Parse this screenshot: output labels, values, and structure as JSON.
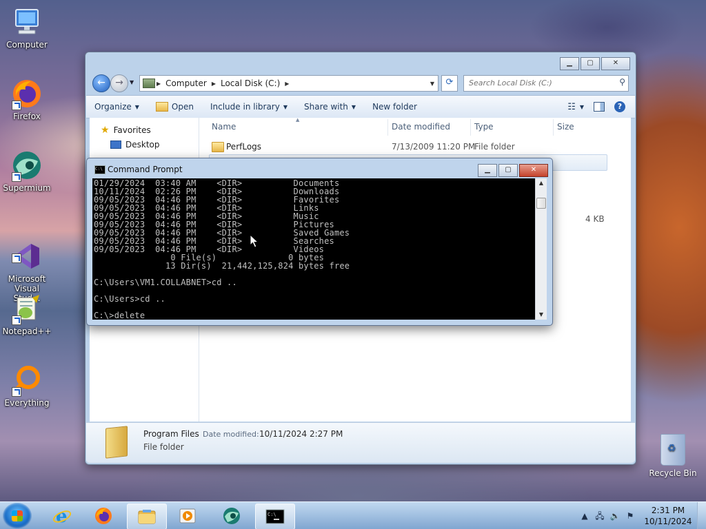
{
  "desktop": {
    "icons": [
      {
        "label": "Computer"
      },
      {
        "label": "Firefox"
      },
      {
        "label": "Supermium"
      },
      {
        "label": "Microsoft\nVisual Stud..."
      },
      {
        "label": "Notepad++"
      },
      {
        "label": "Everything"
      }
    ],
    "recycle_bin": "Recycle Bin"
  },
  "explorer": {
    "address": {
      "segments": [
        "Computer",
        "Local Disk (C:)"
      ]
    },
    "search_placeholder": "Search Local Disk (C:)",
    "toolbar": {
      "organize": "Organize",
      "open": "Open",
      "include_in_library": "Include in library",
      "share_with": "Share with",
      "new_folder": "New folder"
    },
    "nav": {
      "favorites": "Favorites",
      "desktop": "Desktop"
    },
    "columns": {
      "name": "Name",
      "date_modified": "Date modified",
      "type": "Type",
      "size": "Size"
    },
    "rows": [
      {
        "name": "PerfLogs",
        "date": "7/13/2009 11:20 PM",
        "type": "File folder",
        "size": ""
      }
    ],
    "partial_size": "4 KB",
    "details": {
      "name": "Program Files",
      "date_label": "Date modified:",
      "date_value": "10/11/2024 2:27 PM",
      "type": "File folder"
    }
  },
  "cmd": {
    "title": "Command Prompt",
    "icon_text": "C:\\",
    "lines": [
      "01/29/2024  03:40 AM    <DIR>          Documents",
      "10/11/2024  02:26 PM    <DIR>          Downloads",
      "09/05/2023  04:46 PM    <DIR>          Favorites",
      "09/05/2023  04:46 PM    <DIR>          Links",
      "09/05/2023  04:46 PM    <DIR>          Music",
      "09/05/2023  04:46 PM    <DIR>          Pictures",
      "09/05/2023  04:46 PM    <DIR>          Saved Games",
      "09/05/2023  04:46 PM    <DIR>          Searches",
      "09/05/2023  04:46 PM    <DIR>          Videos",
      "               0 File(s)              0 bytes",
      "              13 Dir(s)  21,442,125,824 bytes free",
      "",
      "C:\\Users\\VM1.COLLABNET>cd ..",
      "",
      "C:\\Users>cd ..",
      "",
      "C:\\>delete"
    ]
  },
  "taskbar": {
    "clock_time": "2:31 PM",
    "clock_date": "10/11/2024"
  },
  "colors": {
    "console_bg": "#000000",
    "console_fg": "#c0c0c0",
    "close_button": "#c5422c"
  }
}
